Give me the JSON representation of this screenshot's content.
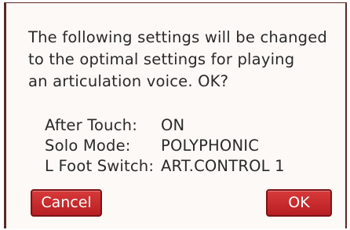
{
  "dialog": {
    "message_lines": [
      "The following settings will be changed",
      "to the optimal settings for playing",
      "an articulation voice. OK?"
    ],
    "settings": [
      {
        "label": "After Touch:",
        "value": "ON"
      },
      {
        "label": "Solo Mode:",
        "value": "POLYPHONIC"
      },
      {
        "label": "L Foot Switch:",
        "value": "ART.CONTROL 1"
      }
    ],
    "cancel_label": "Cancel",
    "ok_label": "OK"
  },
  "colors": {
    "button_red": "#c62a2c",
    "frame_border": "#5a2a26",
    "dialog_bg": "#fdf9f6"
  }
}
